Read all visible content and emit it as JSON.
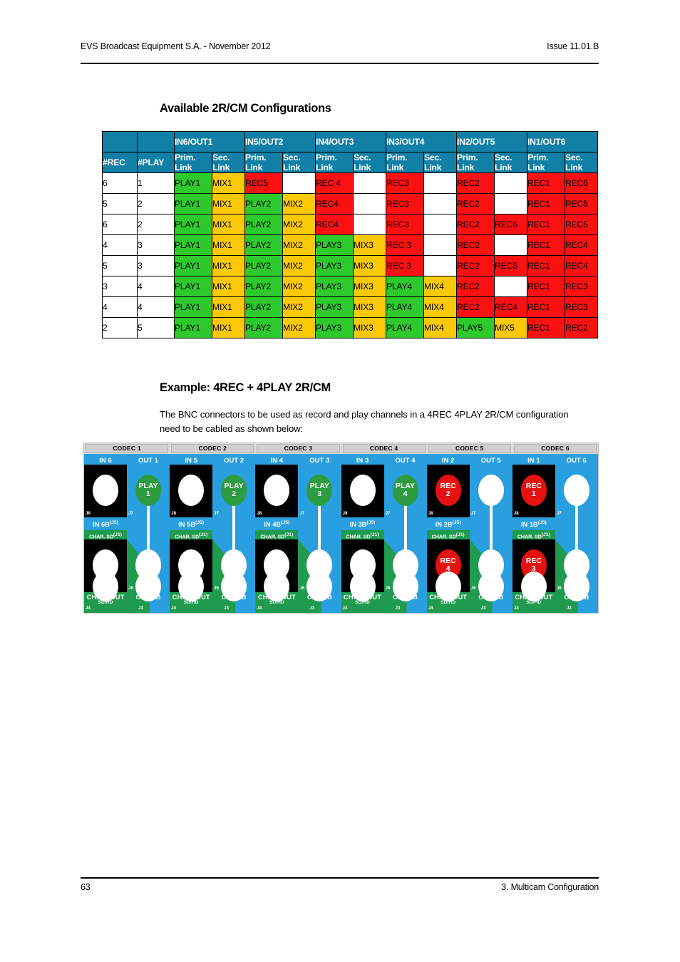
{
  "header": {
    "left": "EVS Broadcast Equipment S.A.  - November 2012",
    "right": "Issue 11.01.B"
  },
  "footer": {
    "page_number": "63",
    "section": "3. Multicam Configuration"
  },
  "table_section": {
    "heading": "Available 2R/CM Configurations",
    "group_headers": [
      "",
      "",
      "IN6/OUT1",
      "IN5/OUT2",
      "IN4/OUT3",
      "IN3/OUT4",
      "IN2/OUT5",
      "IN1/OUT6"
    ],
    "sub_headers": {
      "rec": "#REC",
      "play": "#PLAY",
      "prim": "Prim. Link",
      "prim_l1": "Prim.",
      "prim_l2": "Link",
      "sec_l1": "Sec.",
      "sec_l2": "Link"
    },
    "rows": [
      {
        "rec": "6",
        "play": "1",
        "cells": [
          {
            "text": "PLAY1",
            "kind": "play"
          },
          {
            "text": "MIX1",
            "kind": "mix"
          },
          {
            "text": "REC5",
            "kind": "rec"
          },
          {
            "text": "",
            "kind": "empty"
          },
          {
            "text": "REC 4",
            "kind": "rec"
          },
          {
            "text": "",
            "kind": "empty"
          },
          {
            "text": "REC3",
            "kind": "rec"
          },
          {
            "text": "",
            "kind": "empty"
          },
          {
            "text": "REC2",
            "kind": "rec"
          },
          {
            "text": "",
            "kind": "empty"
          },
          {
            "text": "REC1",
            "kind": "rec"
          },
          {
            "text": "REC6",
            "kind": "rec"
          }
        ]
      },
      {
        "rec": "5",
        "play": "2",
        "cells": [
          {
            "text": "PLAY1",
            "kind": "play"
          },
          {
            "text": "MIX1",
            "kind": "mix"
          },
          {
            "text": "PLAY2",
            "kind": "play"
          },
          {
            "text": "MIX2",
            "kind": "mix"
          },
          {
            "text": "REC4",
            "kind": "rec"
          },
          {
            "text": "",
            "kind": "empty"
          },
          {
            "text": "REC3",
            "kind": "rec"
          },
          {
            "text": "",
            "kind": "empty"
          },
          {
            "text": "REC2",
            "kind": "rec"
          },
          {
            "text": "",
            "kind": "empty"
          },
          {
            "text": "REC1",
            "kind": "rec"
          },
          {
            "text": "REC5",
            "kind": "rec"
          }
        ]
      },
      {
        "rec": "6",
        "play": "2",
        "cells": [
          {
            "text": "PLAY1",
            "kind": "play"
          },
          {
            "text": "MIX1",
            "kind": "mix"
          },
          {
            "text": "PLAY2",
            "kind": "play"
          },
          {
            "text": "MIX2",
            "kind": "mix"
          },
          {
            "text": "REC4",
            "kind": "rec"
          },
          {
            "text": "",
            "kind": "empty"
          },
          {
            "text": "REC3",
            "kind": "rec"
          },
          {
            "text": "",
            "kind": "empty"
          },
          {
            "text": "REC2",
            "kind": "rec"
          },
          {
            "text": "REC6",
            "kind": "rec"
          },
          {
            "text": "REC1",
            "kind": "rec"
          },
          {
            "text": "REC5",
            "kind": "rec"
          }
        ]
      },
      {
        "rec": "4",
        "play": "3",
        "cells": [
          {
            "text": "PLAY1",
            "kind": "play"
          },
          {
            "text": "MIX1",
            "kind": "mix"
          },
          {
            "text": "PLAY2",
            "kind": "play"
          },
          {
            "text": "MIX2",
            "kind": "mix"
          },
          {
            "text": "PLAY3",
            "kind": "play"
          },
          {
            "text": "MIX3",
            "kind": "mix"
          },
          {
            "text": "REC 3",
            "kind": "rec"
          },
          {
            "text": "",
            "kind": "empty"
          },
          {
            "text": "REC2",
            "kind": "rec"
          },
          {
            "text": "",
            "kind": "empty"
          },
          {
            "text": "REC1",
            "kind": "rec"
          },
          {
            "text": "REC4",
            "kind": "rec"
          }
        ]
      },
      {
        "rec": "5",
        "play": "3",
        "cells": [
          {
            "text": "PLAY1",
            "kind": "play"
          },
          {
            "text": "MIX1",
            "kind": "mix"
          },
          {
            "text": "PLAY2",
            "kind": "play"
          },
          {
            "text": "MIX2",
            "kind": "mix"
          },
          {
            "text": "PLAY3",
            "kind": "play"
          },
          {
            "text": "MIX3",
            "kind": "mix"
          },
          {
            "text": "REC 3",
            "kind": "rec"
          },
          {
            "text": "",
            "kind": "empty"
          },
          {
            "text": "REC2",
            "kind": "rec"
          },
          {
            "text": "REC5",
            "kind": "rec"
          },
          {
            "text": "REC1",
            "kind": "rec"
          },
          {
            "text": "REC4",
            "kind": "rec"
          }
        ]
      },
      {
        "rec": "3",
        "play": "4",
        "cells": [
          {
            "text": "PLAY1",
            "kind": "play"
          },
          {
            "text": "MIX1",
            "kind": "mix"
          },
          {
            "text": "PLAY2",
            "kind": "play"
          },
          {
            "text": "MIX2",
            "kind": "mix"
          },
          {
            "text": "PLAY3",
            "kind": "play"
          },
          {
            "text": "MIX3",
            "kind": "mix"
          },
          {
            "text": "PLAY4",
            "kind": "play"
          },
          {
            "text": "MIX4",
            "kind": "mix"
          },
          {
            "text": "REC2",
            "kind": "rec"
          },
          {
            "text": "",
            "kind": "empty"
          },
          {
            "text": "REC1",
            "kind": "rec"
          },
          {
            "text": "REC3",
            "kind": "rec"
          }
        ]
      },
      {
        "rec": "4",
        "play": "4",
        "cells": [
          {
            "text": "PLAY1",
            "kind": "play"
          },
          {
            "text": "MIX1",
            "kind": "mix"
          },
          {
            "text": "PLAY2",
            "kind": "play"
          },
          {
            "text": "MIX2",
            "kind": "mix"
          },
          {
            "text": "PLAY3",
            "kind": "play"
          },
          {
            "text": "MIX3",
            "kind": "mix"
          },
          {
            "text": "PLAY4",
            "kind": "play"
          },
          {
            "text": "MIX4",
            "kind": "mix"
          },
          {
            "text": "REC2",
            "kind": "rec"
          },
          {
            "text": "REC4",
            "kind": "rec"
          },
          {
            "text": "REC1",
            "kind": "rec"
          },
          {
            "text": "REC3",
            "kind": "rec"
          }
        ]
      },
      {
        "rec": "2",
        "play": "5",
        "cells": [
          {
            "text": "PLAY1",
            "kind": "play"
          },
          {
            "text": "MIX1",
            "kind": "mix"
          },
          {
            "text": "PLAY2",
            "kind": "play"
          },
          {
            "text": "MIX2",
            "kind": "mix"
          },
          {
            "text": "PLAY3",
            "kind": "play"
          },
          {
            "text": "MIX3",
            "kind": "mix"
          },
          {
            "text": "PLAY4",
            "kind": "play"
          },
          {
            "text": "MIX4",
            "kind": "mix"
          },
          {
            "text": "PLAY5",
            "kind": "play"
          },
          {
            "text": "MIX5",
            "kind": "mix"
          },
          {
            "text": "REC1",
            "kind": "rec"
          },
          {
            "text": "REC2",
            "kind": "rec"
          }
        ]
      }
    ]
  },
  "example_section": {
    "heading": "Example: 4REC + 4PLAY 2R/CM",
    "paragraph": "The BNC connectors to be used as record and play channels in a 4REC 4PLAY 2R/CM configuration need to be cabled as shown below:"
  },
  "diagram": {
    "common": {
      "char_sd": "CHAR. SD",
      "char_sd_ref": "(J1)",
      "char_out": "CHAR. OUT",
      "char_out_sub": "SD/HD",
      "inb_ref": "(J5)",
      "j8": "J8",
      "j7": "J7",
      "j6": "J6",
      "j4": "J4",
      "j3": "J3"
    },
    "codecs": [
      {
        "title": "CODEC 1",
        "in_label": "IN 6",
        "out_label": "OUT 1",
        "inb_label": "IN 6B",
        "outb_label": "OUT 1B",
        "in_top_badge": null,
        "in_bottom_badge": null,
        "out_top_badge": {
          "line1": "PLAY",
          "line2": "1",
          "kind": "play"
        }
      },
      {
        "title": "CODEC 2",
        "in_label": "IN 5",
        "out_label": "OUT 2",
        "inb_label": "IN 5B",
        "outb_label": "OUT 2B",
        "in_top_badge": null,
        "in_bottom_badge": null,
        "out_top_badge": {
          "line1": "PLAY",
          "line2": "2",
          "kind": "play"
        }
      },
      {
        "title": "CODEC 3",
        "in_label": "IN 4",
        "out_label": "OUT 3",
        "inb_label": "IN 4B",
        "outb_label": "OUT 3B",
        "in_top_badge": null,
        "in_bottom_badge": null,
        "out_top_badge": {
          "line1": "PLAY",
          "line2": "3",
          "kind": "play"
        }
      },
      {
        "title": "CODEC 4",
        "in_label": "IN 3",
        "out_label": "OUT 4",
        "inb_label": "IN 3B",
        "outb_label": "OUT 4B",
        "in_top_badge": null,
        "in_bottom_badge": null,
        "out_top_badge": {
          "line1": "PLAY",
          "line2": "4",
          "kind": "play"
        }
      },
      {
        "title": "CODEC 5",
        "in_label": "IN 2",
        "out_label": "OUT 5",
        "inb_label": "IN 2B",
        "outb_label": "OUT 5B",
        "in_top_badge": {
          "line1": "REC",
          "line2": "2",
          "kind": "rec"
        },
        "in_bottom_badge": {
          "line1": "REC",
          "line2": "4",
          "kind": "rec"
        },
        "out_top_badge": null
      },
      {
        "title": "CODEC 6",
        "in_label": "IN 1",
        "out_label": "OUT 6",
        "inb_label": "IN 1B",
        "outb_label": "OUT 6B",
        "in_top_badge": {
          "line1": "REC",
          "line2": "1",
          "kind": "rec"
        },
        "in_bottom_badge": {
          "line1": "REC",
          "line2": "3",
          "kind": "rec"
        },
        "out_top_badge": null
      }
    ]
  },
  "colors": {
    "table_header": "#1280a6",
    "play": "#2dc92d",
    "mix": "#fbc908",
    "rec": "#fb1111",
    "panel_blue": "#2a9fdf",
    "panel_green": "#1f9a4e",
    "badge_play": "#2d9b3f",
    "badge_rec": "#e51111"
  }
}
